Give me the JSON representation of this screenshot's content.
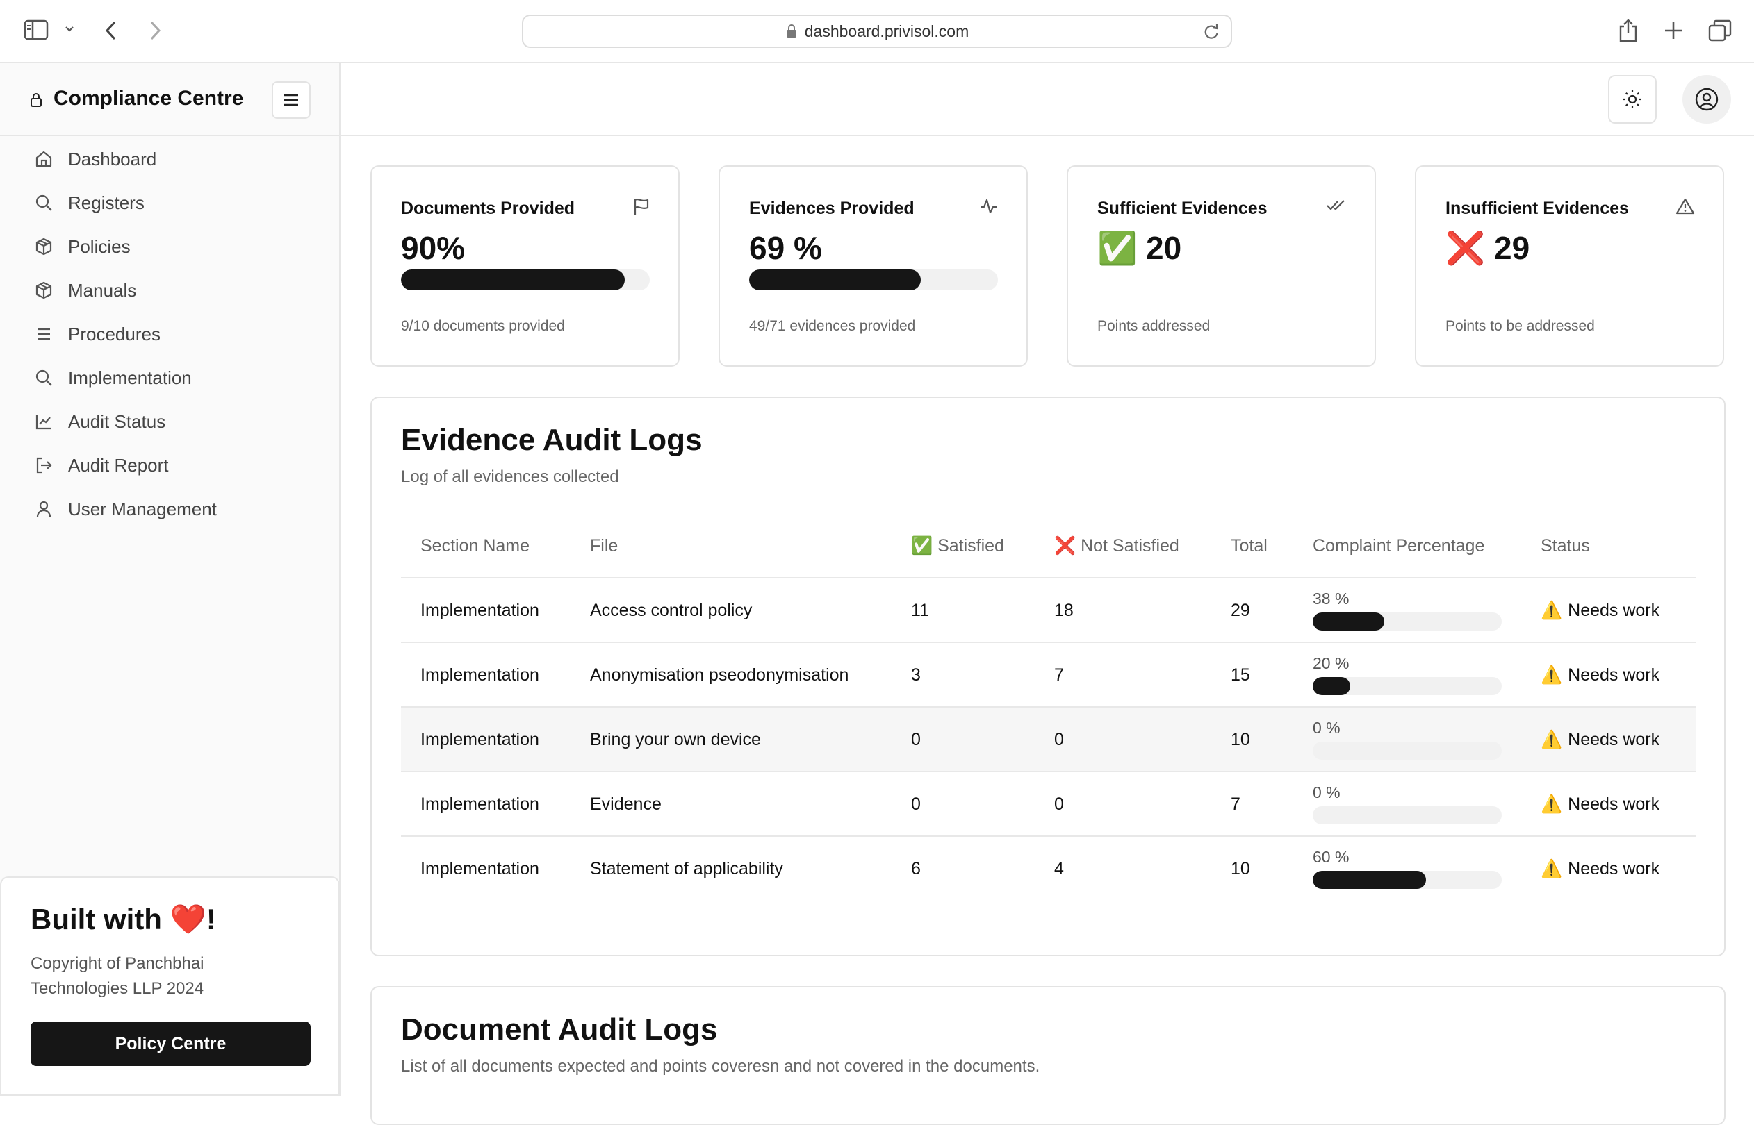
{
  "browser": {
    "url": "dashboard.privisol.com"
  },
  "sidebar": {
    "title": "Compliance Centre",
    "items": [
      {
        "label": "Dashboard",
        "icon": "home-icon"
      },
      {
        "label": "Registers",
        "icon": "search-icon"
      },
      {
        "label": "Policies",
        "icon": "package-icon"
      },
      {
        "label": "Manuals",
        "icon": "package-icon"
      },
      {
        "label": "Procedures",
        "icon": "list-icon"
      },
      {
        "label": "Implementation",
        "icon": "search-icon"
      },
      {
        "label": "Audit Status",
        "icon": "line-chart-icon"
      },
      {
        "label": "Audit Report",
        "icon": "log-out-icon"
      },
      {
        "label": "User Management",
        "icon": "user-icon"
      }
    ],
    "footer": {
      "title": "Built with ❤️!",
      "copyright": "Copyright of Panchbhai Technologies LLP 2024",
      "button": "Policy Centre"
    }
  },
  "cards": [
    {
      "title": "Documents Provided",
      "value": "90%",
      "progress": 0.9,
      "sub": "9/10 documents provided",
      "icon": "flag-icon"
    },
    {
      "title": "Evidences Provided",
      "value": "69 %",
      "progress": 0.69,
      "sub": "49/71 evidences provided",
      "icon": "activity-icon"
    },
    {
      "title": "Sufficient Evidences",
      "value": "✅ 20",
      "sub": "Points addressed",
      "icon": "check-check-icon"
    },
    {
      "title": "Insufficient Evidences",
      "value": "❌ 29",
      "sub": "Points to be addressed",
      "icon": "alert-triangle-icon"
    }
  ],
  "evidence": {
    "title": "Evidence Audit Logs",
    "subtitle": "Log of all evidences collected",
    "headers": [
      "Section Name",
      "File",
      "✅ Satisfied",
      "❌ Not Satisfied",
      "Total",
      "Complaint Percentage",
      "Status"
    ],
    "rows": [
      {
        "section": "Implementation",
        "file": "Access control policy",
        "satisfied": "11",
        "not_satisfied": "18",
        "total": "29",
        "pct_label": "38 %",
        "pct": 0.38,
        "status": "Needs work"
      },
      {
        "section": "Implementation",
        "file": "Anonymisation pseodonymisation",
        "satisfied": "3",
        "not_satisfied": "7",
        "total": "15",
        "pct_label": "20 %",
        "pct": 0.2,
        "status": "Needs work"
      },
      {
        "section": "Implementation",
        "file": "Bring your own device",
        "satisfied": "0",
        "not_satisfied": "0",
        "total": "10",
        "pct_label": "0 %",
        "pct": 0,
        "status": "Needs work"
      },
      {
        "section": "Implementation",
        "file": "Evidence",
        "satisfied": "0",
        "not_satisfied": "0",
        "total": "7",
        "pct_label": "0 %",
        "pct": 0,
        "status": "Needs work"
      },
      {
        "section": "Implementation",
        "file": "Statement of applicability",
        "satisfied": "6",
        "not_satisfied": "4",
        "total": "10",
        "pct_label": "60 %",
        "pct": 0.6,
        "status": "Needs work"
      }
    ]
  },
  "documents": {
    "title": "Document Audit Logs",
    "subtitle": "List of all documents expected and points coveresn and not covered in the documents."
  },
  "colors": {
    "accent": "#161616",
    "border": "#e3e3e3",
    "muted": "#666666"
  }
}
